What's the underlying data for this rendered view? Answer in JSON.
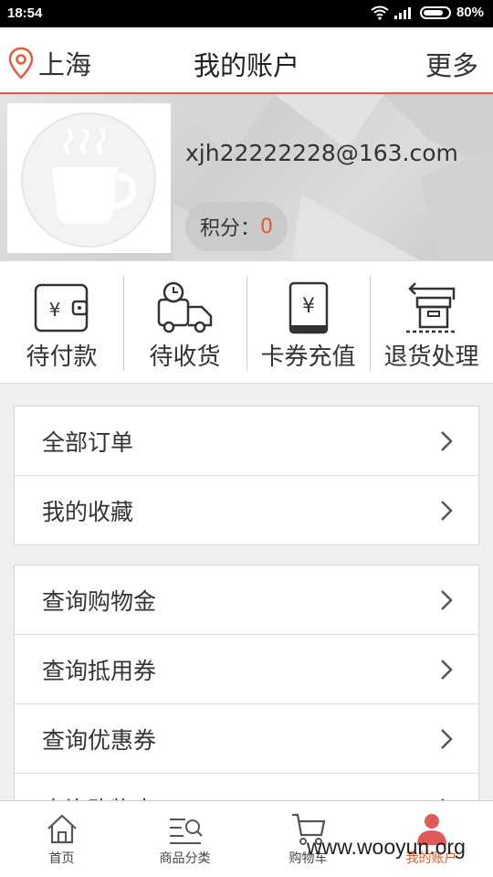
{
  "status_bar": {
    "time": "18:54",
    "battery": "80%",
    "battery_fraction": 0.8
  },
  "header": {
    "location": "上海",
    "title": "我的账户",
    "more": "更多"
  },
  "profile": {
    "email": "xjh22222228@163.com",
    "points_label": "积分：",
    "points_value": "0"
  },
  "orders": [
    {
      "label": "待付款",
      "icon": "wallet-icon"
    },
    {
      "label": "待收货",
      "icon": "delivery-truck-icon"
    },
    {
      "label": "卡券充值",
      "icon": "phone-yen-icon"
    },
    {
      "label": "退货处理",
      "icon": "return-box-icon"
    }
  ],
  "menu_group1": [
    "全部订单",
    "我的收藏"
  ],
  "menu_group2": [
    "查询购物金",
    "查询抵用券",
    "查询优惠券",
    "查询购物卡"
  ],
  "tabs": [
    {
      "label": "首页",
      "icon": "home-icon"
    },
    {
      "label": "商品分类",
      "icon": "category-search-icon"
    },
    {
      "label": "购物车",
      "icon": "cart-icon"
    },
    {
      "label": "我的账户",
      "icon": "user-icon"
    }
  ],
  "active_tab": "我的账户",
  "watermark": "www.wooyun.org",
  "colors": {
    "accent": "#e05a2b",
    "text": "#333333",
    "background": "#efefef"
  }
}
